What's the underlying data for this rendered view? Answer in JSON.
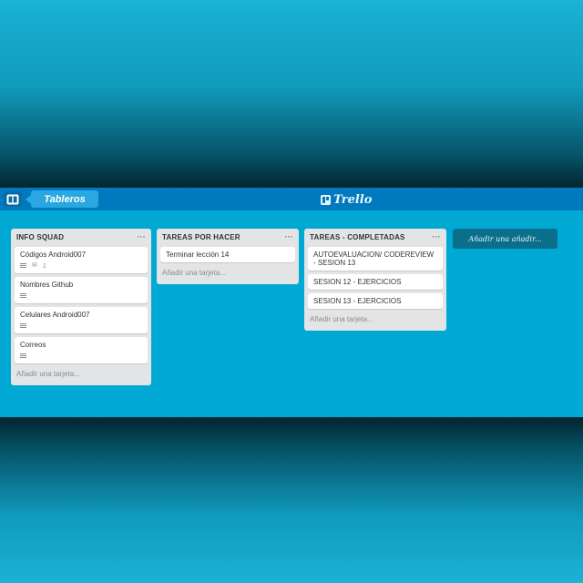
{
  "header": {
    "boards_label": "Tableros",
    "brand": "Trello",
    "logo_icon": "boards-icon",
    "colors": {
      "header": "#0079bf",
      "board": "#00a9d3"
    }
  },
  "lists": [
    {
      "title": "INFO SQUAD",
      "menu": "···",
      "cards": [
        {
          "title": "Códigos Android007",
          "comments": "1"
        },
        {
          "title": "Nombres Github"
        },
        {
          "title": "Celulares Android007"
        },
        {
          "title": "Correos"
        }
      ],
      "add_card": "Añadir una tarjeta..."
    },
    {
      "title": "TAREAS POR HACER",
      "menu": "···",
      "cards": [
        {
          "title": "Terminar lección 14"
        }
      ],
      "add_card": "Añadir una tarjeta..."
    },
    {
      "title": "TAREAS - COMPLETADAS",
      "menu": "···",
      "cards": [
        {
          "title": "AUTOEVALUACION/ CODEREVIEW - SESION 13"
        },
        {
          "title": "SESION 12 - EJERCICIOS"
        },
        {
          "title": "SESION 13 - EJERCICIOS"
        }
      ],
      "add_card": "Añadir una tarjeta..."
    }
  ],
  "add_list": "Añadir una añadir..."
}
